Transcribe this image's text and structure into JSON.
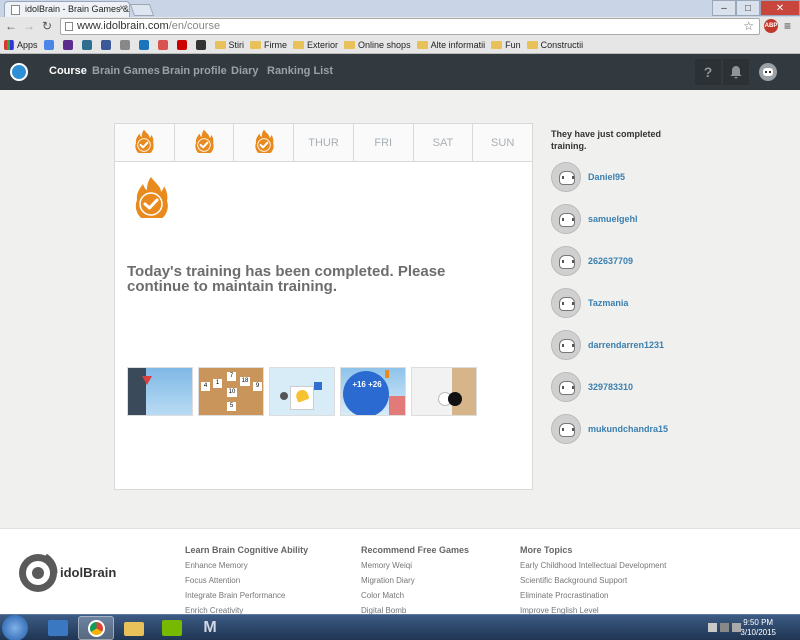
{
  "browser": {
    "tab_title": "idolBrain - Brain Games &",
    "url_host": "www.idolbrain.com",
    "url_path": "/en/course",
    "abp_label": "ABP",
    "bookmarks": [
      {
        "label": "Apps",
        "type": "apps"
      },
      {
        "label": "",
        "type": "site",
        "color": "#4a86e8"
      },
      {
        "label": "",
        "type": "site",
        "color": "#5b2d8e"
      },
      {
        "label": "",
        "type": "site",
        "color": "#2e6e8e"
      },
      {
        "label": "",
        "type": "site",
        "color": "#3b5998"
      },
      {
        "label": "",
        "type": "site",
        "color": "#888888"
      },
      {
        "label": "",
        "type": "site",
        "color": "#1a75bc"
      },
      {
        "label": "",
        "type": "site",
        "color": "#d9534f"
      },
      {
        "label": "",
        "type": "site",
        "color": "#cc0000"
      },
      {
        "label": "",
        "type": "site",
        "color": "#333333"
      },
      {
        "label": "Stiri",
        "type": "folder"
      },
      {
        "label": "Firme",
        "type": "folder"
      },
      {
        "label": "Exterior",
        "type": "folder"
      },
      {
        "label": "Online shops",
        "type": "folder"
      },
      {
        "label": "Alte informatii",
        "type": "folder"
      },
      {
        "label": "Fun",
        "type": "folder"
      },
      {
        "label": "Constructii",
        "type": "folder"
      }
    ]
  },
  "header": {
    "nav": [
      "Course",
      "Brain Games",
      "Brain profile",
      "Diary",
      "Ranking List"
    ],
    "help_label": "?"
  },
  "week": {
    "days": [
      {
        "label": "",
        "done": true
      },
      {
        "label": "",
        "done": true
      },
      {
        "label": "",
        "done": true
      },
      {
        "label": "THUR",
        "done": false
      },
      {
        "label": "FRI",
        "done": false
      },
      {
        "label": "SAT",
        "done": false
      },
      {
        "label": "SUN",
        "done": false
      }
    ]
  },
  "main": {
    "completed_message": "Today's training has been completed. Please continue to maintain training.",
    "game_numbers": [
      "4",
      "1",
      "7",
      "18",
      "9",
      "10",
      "5"
    ],
    "bomb_text": "+16 +26"
  },
  "sidebar": {
    "title": "They have just completed training.",
    "users": [
      "Daniel95",
      "samuelgehl",
      "262637709",
      "Tazmania",
      "darrendarren1231",
      "329783310",
      "mukundchandra15"
    ]
  },
  "footer": {
    "brand": "idolBrain",
    "columns": [
      {
        "heading": "Learn Brain Cognitive Ability",
        "links": [
          "Enhance Memory",
          "Focus Attention",
          "Integrate Brain Performance",
          "Enrich Creativity"
        ]
      },
      {
        "heading": "Recommend Free Games",
        "links": [
          "Memory Weiqi",
          "Migration Diary",
          "Color Match",
          "Digital Bomb"
        ]
      },
      {
        "heading": "More Topics",
        "links": [
          "Early Childhood Intellectual Development",
          "Scientific Background Support",
          "Eliminate Procrastination",
          "Improve English Level"
        ]
      }
    ]
  },
  "taskbar": {
    "time": "9:50 PM",
    "date": "3/10/2015"
  },
  "colors": {
    "flame": "#e88a1e",
    "header_bg": "#333a3f",
    "link": "#3a7fb0"
  }
}
